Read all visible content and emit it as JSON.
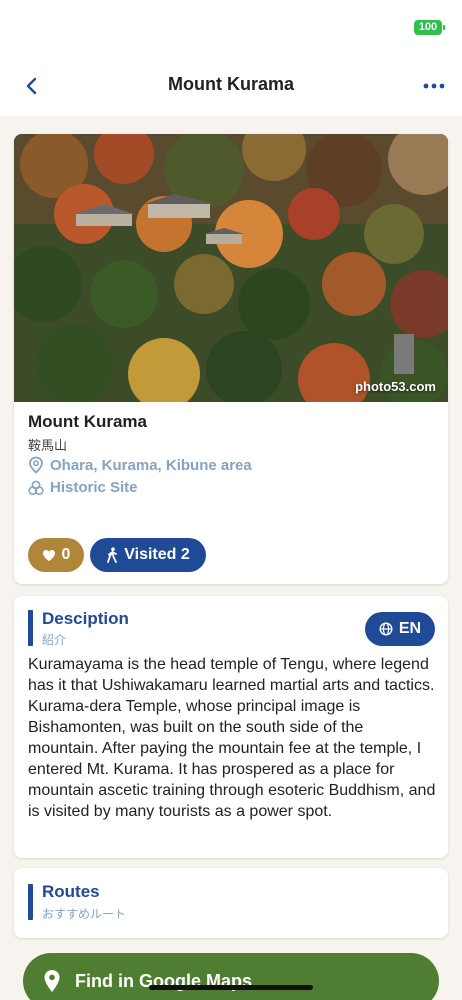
{
  "status_bar": {
    "battery": "100",
    "battery_color": "#2fbf4a"
  },
  "nav": {
    "title": "Mount Kurama",
    "back_icon": "chevron-left-icon",
    "more_icon": "ellipsis-icon"
  },
  "spot": {
    "photo_credit": "photo53.com",
    "name": "Mount Kurama",
    "name_jp": "鞍馬山",
    "area": "Ohara, Kurama, Kibune area",
    "category": "Historic Site",
    "likes": "0",
    "visited_label": "Visited 2"
  },
  "description": {
    "title": "Desciption",
    "subtitle": "紹介",
    "language": "EN",
    "body": "Kuramayama is the head temple of Tengu, where legend has it that Ushiwakamaru learned martial arts and tactics. Kurama-dera Temple, whose principal image is Bishamonten, was built on the south side of the mountain. After paying the mountain fee at the temple, I entered Mt. Kurama. It has prospered as a place for mountain ascetic training through esoteric Buddhism, and is visited by many tourists as a power spot."
  },
  "routes": {
    "title": "Routes",
    "subtitle": "おすすめルート"
  },
  "maps_button": {
    "label": "Find in Google Maps"
  },
  "colors": {
    "accent": "#1f4a96",
    "like": "#b0863a",
    "maps": "#4f7d31",
    "meta": "#86a3c2",
    "background": "#f7f3ee"
  }
}
